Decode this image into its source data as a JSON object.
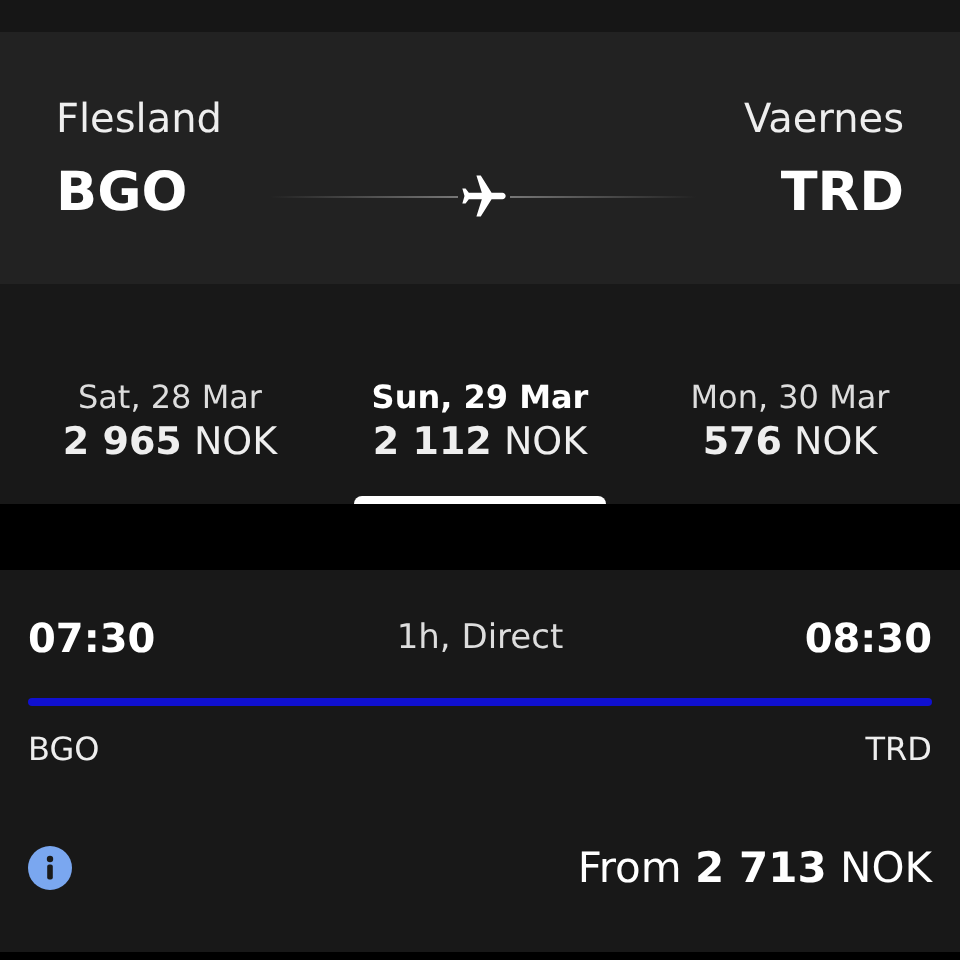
{
  "route": {
    "origin": {
      "name": "Flesland",
      "code": "BGO"
    },
    "destination": {
      "name": "Vaernes",
      "code": "TRD"
    }
  },
  "dates": [
    {
      "label": "Sat, 28 Mar",
      "price": "**2 965** NOK",
      "selected": false
    },
    {
      "label": "Sun, 29 Mar",
      "price": "**2 112** NOK",
      "selected": true
    },
    {
      "label": "Mon, 30 Mar",
      "price": "**576** NOK",
      "selected": false
    }
  ],
  "flight": {
    "departure": "07:30",
    "duration": "1h, Direct",
    "arrival": "08:30",
    "from_code": "BGO",
    "to_code": "TRD",
    "price": "From **2 713** NOK"
  }
}
